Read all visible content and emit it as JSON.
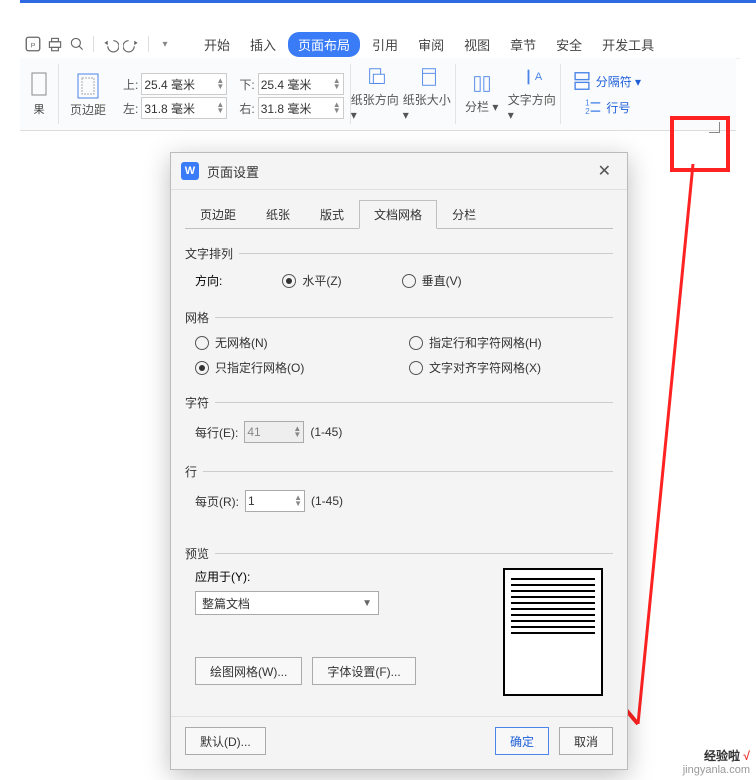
{
  "menu": {
    "tabs": [
      "开始",
      "插入",
      "页面布局",
      "引用",
      "审阅",
      "视图",
      "章节",
      "安全",
      "开发工具"
    ],
    "active_index": 2
  },
  "ribbon": {
    "margins": {
      "label": "页边距",
      "top_lbl": "上:",
      "top_val": "25.4 毫米",
      "bottom_lbl": "下:",
      "bottom_val": "25.4 毫米",
      "left_lbl": "左:",
      "left_val": "31.8 毫米",
      "right_lbl": "右:",
      "right_val": "31.8 毫米"
    },
    "orientation": "纸张方向",
    "size": "纸张大小",
    "columns": "分栏",
    "textdir": "文字方向",
    "separator": "分隔符",
    "lineno": "行号",
    "result_label": "果"
  },
  "dialog": {
    "title": "页面设置",
    "tabs": [
      "页边距",
      "纸张",
      "版式",
      "文档网格",
      "分栏"
    ],
    "active_tab_index": 3,
    "text_arrange": {
      "legend": "文字排列",
      "dir_label": "方向:",
      "horiz": "水平(Z)",
      "vert": "垂直(V)"
    },
    "grid": {
      "legend": "网格",
      "opt_none": "无网格(N)",
      "opt_rowchar": "指定行和字符网格(H)",
      "opt_rowonly": "只指定行网格(O)",
      "opt_align": "文字对齐字符网格(X)"
    },
    "chars": {
      "legend": "字符",
      "per_line_lbl": "每行(E):",
      "per_line_val": "41",
      "range": "(1-45)"
    },
    "rows": {
      "legend": "行",
      "per_page_lbl": "每页(R):",
      "per_page_val": "1",
      "range": "(1-45)"
    },
    "preview": {
      "legend": "预览",
      "apply_lbl": "应用于(Y):",
      "apply_val": "整篇文档"
    },
    "buttons": {
      "draw_grid": "绘图网格(W)...",
      "font": "字体设置(F)...",
      "default": "默认(D)...",
      "ok": "确定",
      "cancel": "取消"
    }
  },
  "watermark": {
    "line1": "经验啦",
    "check": "√",
    "line2": "jingyanla.com"
  }
}
